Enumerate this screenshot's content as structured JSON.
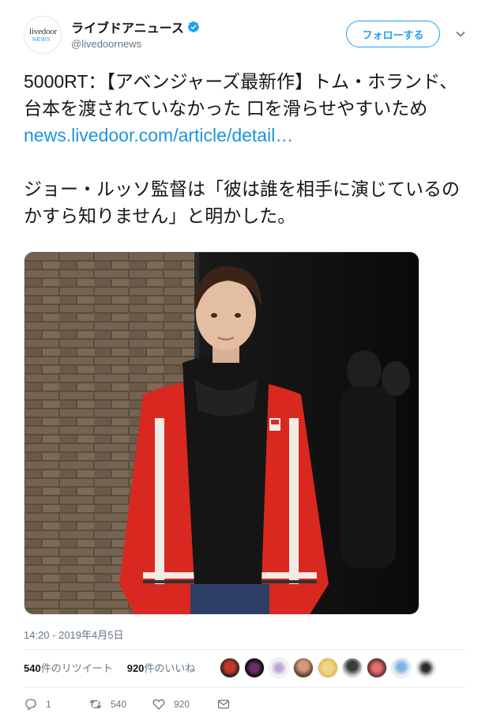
{
  "account": {
    "display_name": "ライブドアニュース",
    "handle": "@livedoornews",
    "avatar_text_top": "livedoor",
    "avatar_text_bottom": "NEWS",
    "verified": true
  },
  "header": {
    "follow_label": "フォローする"
  },
  "tweet": {
    "line1": "5000RT：【アベンジャーズ最新作】トム・ホランド、台本を渡されていなかった 口を滑らせやすいため",
    "link": "news.livedoor.com/article/detail…",
    "line2": "ジョー・ルッソ監督は「彼は誰を相手に演じているのかすら知りません」と明かした。"
  },
  "timestamp": "14:20 - 2019年4月5日",
  "stats": {
    "retweets_count": "540",
    "retweets_label": "件のリツイート",
    "likes_count": "920",
    "likes_label": "件のいいね"
  },
  "actions": {
    "reply_count": "1",
    "retweet_count": "540",
    "like_count": "920"
  },
  "colors": {
    "accent": "#1da1f2",
    "link": "#1b95e0",
    "muted": "#657786"
  },
  "icons": [
    "verified-badge-icon",
    "chevron-down-icon",
    "reply-icon",
    "retweet-icon",
    "heart-icon",
    "message-icon"
  ]
}
